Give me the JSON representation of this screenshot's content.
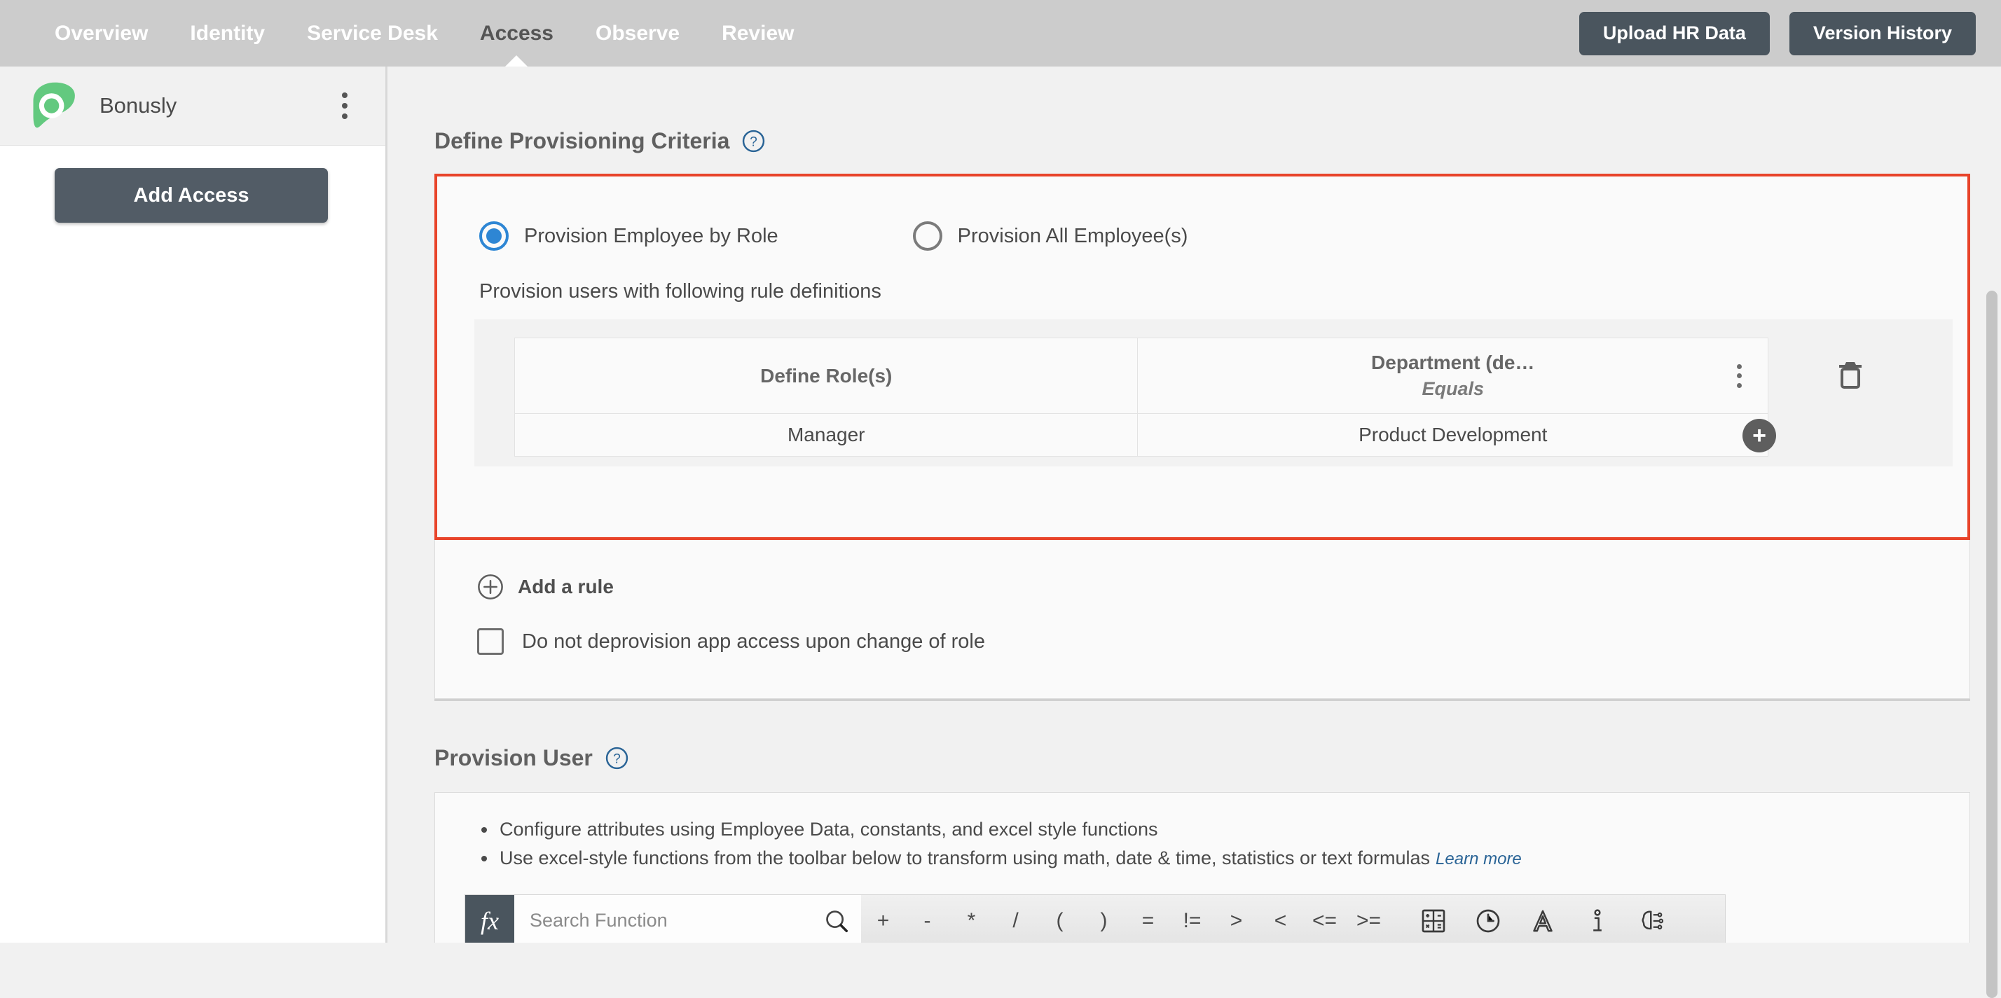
{
  "nav": {
    "items": [
      {
        "label": "Overview",
        "active": false
      },
      {
        "label": "Identity",
        "active": false
      },
      {
        "label": "Service Desk",
        "active": false
      },
      {
        "label": "Access",
        "active": true
      },
      {
        "label": "Observe",
        "active": false
      },
      {
        "label": "Review",
        "active": false
      }
    ],
    "upload_button": "Upload HR Data",
    "version_button": "Version History"
  },
  "sidebar": {
    "app_name": "Bonusly",
    "app_logo_icon": "bonusly-logo-icon",
    "app_menu_icon": "kebab-menu-icon",
    "add_access_button": "Add Access"
  },
  "criteria": {
    "title": "Define Provisioning Criteria",
    "help_icon": "help-circle-icon",
    "radios": [
      {
        "label": "Provision Employee by Role",
        "selected": true
      },
      {
        "label": "Provision All Employee(s)",
        "selected": false
      }
    ],
    "rule_caption": "Provision users with following rule definitions",
    "table": {
      "columns": [
        {
          "header": "Define Role(s)",
          "operator": ""
        },
        {
          "header": "Department (de…",
          "operator": "Equals",
          "menu_icon": "kebab-menu-icon"
        }
      ],
      "rows": [
        [
          "Manager",
          "Product Development"
        ]
      ],
      "delete_icon": "trash-icon",
      "add_value_icon": "plus-circle-icon"
    },
    "add_rule": {
      "label": "Add a rule",
      "icon": "circle-plus-icon"
    },
    "deprovision_checkbox": {
      "label": "Do not deprovision app access upon change of role",
      "checked": false
    }
  },
  "provision_user": {
    "title": "Provision User",
    "help_icon": "help-circle-icon",
    "bullets": [
      "Configure attributes using Employee Data, constants, and excel style functions",
      "Use excel-style functions from the toolbar below to transform using math, date & time, statistics or text formulas"
    ],
    "learn_more": "Learn more",
    "toolbar": {
      "fx_label": "fx",
      "search_placeholder": "Search Function",
      "search_value": "",
      "search_icon": "search-icon",
      "operators": [
        "+",
        "-",
        "*",
        "/",
        "(",
        ")",
        "=",
        "!=",
        ">",
        "<",
        "<=",
        ">="
      ],
      "category_icons": [
        "calculator-math-icon",
        "clock-datetime-icon",
        "text-letter-a-icon",
        "info-statistics-icon",
        "brain-ai-icon"
      ]
    }
  },
  "colors": {
    "accent_red": "#E8442A",
    "accent_blue": "#2E86D4",
    "dark_button": "#4A555E",
    "nav_background": "#CCCCCC",
    "brand_green": "#63C97F",
    "link_blue": "#2A6496"
  },
  "scrollbar": {
    "name": "vertical-scrollbar"
  }
}
